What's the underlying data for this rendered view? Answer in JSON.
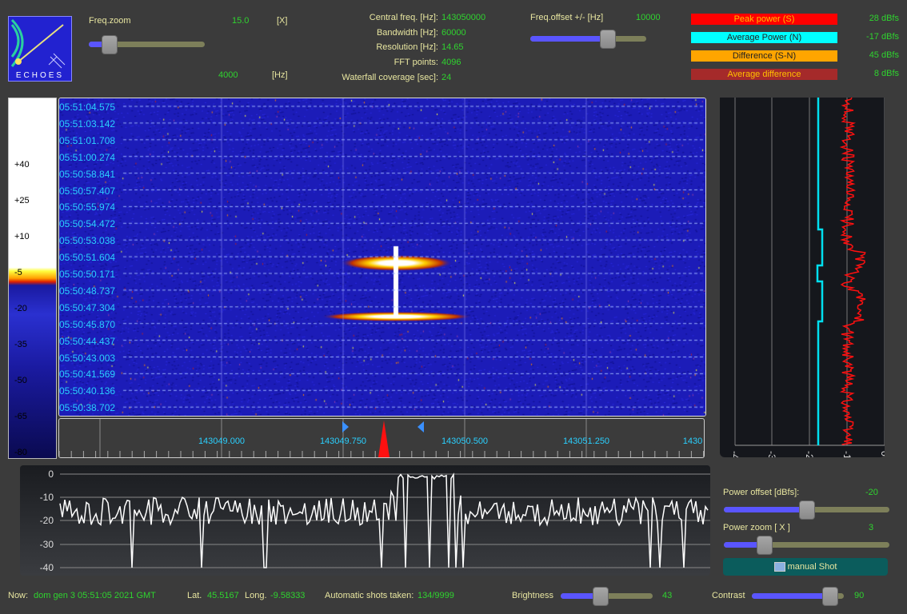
{
  "logo": {
    "text": "ECHOES"
  },
  "freq_zoom": {
    "label": "Freq.zoom",
    "value": "15.0",
    "unit": "[X]",
    "slider_fraction": 0.12,
    "lower_value": "4000",
    "lower_unit": "[Hz]"
  },
  "info": [
    {
      "label": "Central freq. [Hz]:",
      "value": "143050000"
    },
    {
      "label": "Bandwidth  [Hz]:",
      "value": "60000"
    },
    {
      "label": "Resolution [Hz]:",
      "value": "14.65"
    },
    {
      "label": "FFT points:",
      "value": "4096"
    },
    {
      "label": "Waterfall coverage [sec]:",
      "value": "24"
    }
  ],
  "freq_offset": {
    "label": "Freq.offset +/- [Hz]",
    "value": "10000",
    "slider_fraction": 0.66
  },
  "indicators": [
    {
      "label": "Peak power (S)",
      "value": "28 dBfs",
      "bg": "#ff0000",
      "fg": "#ffc000"
    },
    {
      "label": "Average Power (N)",
      "value": "-17 dBfs",
      "bg": "#00ffff",
      "fg": "#222222"
    },
    {
      "label": "Difference (S-N)",
      "value": "45 dBfs",
      "bg": "#ffa500",
      "fg": "#222222"
    },
    {
      "label": "Average difference",
      "value": "8 dBfs",
      "bg": "#a52a2a",
      "fg": "#ffc000"
    }
  ],
  "color_scale": {
    "labels": [
      "+40",
      "+25",
      "+10",
      "-5",
      "-20",
      "-35",
      "-50",
      "-65",
      "-80"
    ]
  },
  "waterfall": {
    "timestamps": [
      "05:51:04.575",
      "05:51:03.142",
      "05:51:01.708",
      "05:51:00.274",
      "05:50:58.841",
      "05:50:57.407",
      "05:50:55.974",
      "05:50:54.472",
      "05:50:53.038",
      "05:50:51.604",
      "05:50:50.171",
      "05:50:48.737",
      "05:50:47.304",
      "05:50:45.870",
      "05:50:44.437",
      "05:50:43.003",
      "05:50:41.569",
      "05:50:40.136",
      "05:50:38.702"
    ]
  },
  "freq_axis": {
    "labels": [
      "143049.000",
      "143049.750",
      "143050.500",
      "143051.250",
      "1430"
    ]
  },
  "power_panel": {
    "axis_labels": [
      "-40",
      "-30",
      "-20",
      "-10",
      "0"
    ]
  },
  "spectrum": {
    "y_labels": [
      "0",
      "-10",
      "-20",
      "-30",
      "-40"
    ]
  },
  "power_offset": {
    "label": "Power offset [dBfs]:",
    "value": "-20",
    "slider_fraction": 0.5
  },
  "power_zoom": {
    "label": "Power zoom  [ X ]",
    "value": "3",
    "slider_fraction": 0.24
  },
  "manual_shot": {
    "label": "manual Shot",
    "icon": "camera-icon"
  },
  "status": {
    "now_label": "Now:",
    "now_value": "dom gen 3 05:51:05 2021 GMT",
    "lat_label": "Lat.",
    "lat_value": "45.5167",
    "long_label": "Long.",
    "long_value": "-9.58333",
    "shots_label": "Automatic shots taken:",
    "shots_value": "134/9999"
  },
  "brightness": {
    "label": "Brightness",
    "value": "43",
    "slider_fraction": 0.43
  },
  "contrast": {
    "label": "Contrast",
    "value": "90",
    "slider_fraction": 0.9
  }
}
